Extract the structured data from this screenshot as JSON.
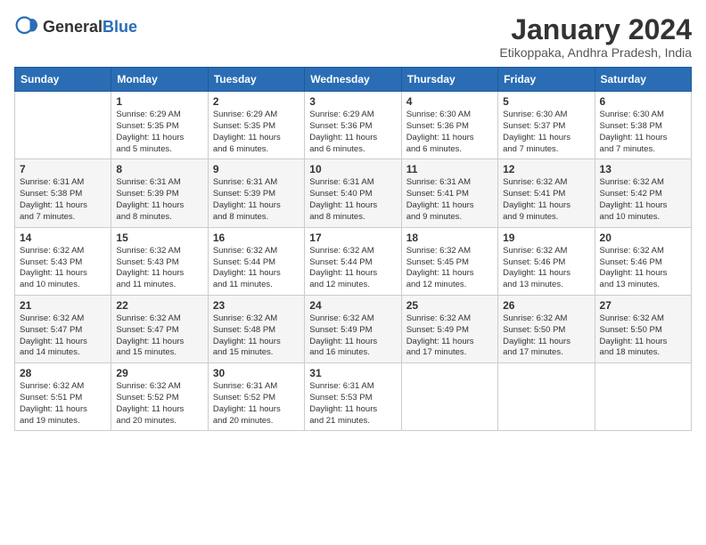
{
  "header": {
    "logo_general": "General",
    "logo_blue": "Blue",
    "month_title": "January 2024",
    "subtitle": "Etikoppaka, Andhra Pradesh, India"
  },
  "days_of_week": [
    "Sunday",
    "Monday",
    "Tuesday",
    "Wednesday",
    "Thursday",
    "Friday",
    "Saturday"
  ],
  "weeks": [
    [
      {
        "day": "",
        "info": ""
      },
      {
        "day": "1",
        "info": "Sunrise: 6:29 AM\nSunset: 5:35 PM\nDaylight: 11 hours\nand 5 minutes."
      },
      {
        "day": "2",
        "info": "Sunrise: 6:29 AM\nSunset: 5:35 PM\nDaylight: 11 hours\nand 6 minutes."
      },
      {
        "day": "3",
        "info": "Sunrise: 6:29 AM\nSunset: 5:36 PM\nDaylight: 11 hours\nand 6 minutes."
      },
      {
        "day": "4",
        "info": "Sunrise: 6:30 AM\nSunset: 5:36 PM\nDaylight: 11 hours\nand 6 minutes."
      },
      {
        "day": "5",
        "info": "Sunrise: 6:30 AM\nSunset: 5:37 PM\nDaylight: 11 hours\nand 7 minutes."
      },
      {
        "day": "6",
        "info": "Sunrise: 6:30 AM\nSunset: 5:38 PM\nDaylight: 11 hours\nand 7 minutes."
      }
    ],
    [
      {
        "day": "7",
        "info": "Sunrise: 6:31 AM\nSunset: 5:38 PM\nDaylight: 11 hours\nand 7 minutes."
      },
      {
        "day": "8",
        "info": "Sunrise: 6:31 AM\nSunset: 5:39 PM\nDaylight: 11 hours\nand 8 minutes."
      },
      {
        "day": "9",
        "info": "Sunrise: 6:31 AM\nSunset: 5:39 PM\nDaylight: 11 hours\nand 8 minutes."
      },
      {
        "day": "10",
        "info": "Sunrise: 6:31 AM\nSunset: 5:40 PM\nDaylight: 11 hours\nand 8 minutes."
      },
      {
        "day": "11",
        "info": "Sunrise: 6:31 AM\nSunset: 5:41 PM\nDaylight: 11 hours\nand 9 minutes."
      },
      {
        "day": "12",
        "info": "Sunrise: 6:32 AM\nSunset: 5:41 PM\nDaylight: 11 hours\nand 9 minutes."
      },
      {
        "day": "13",
        "info": "Sunrise: 6:32 AM\nSunset: 5:42 PM\nDaylight: 11 hours\nand 10 minutes."
      }
    ],
    [
      {
        "day": "14",
        "info": "Sunrise: 6:32 AM\nSunset: 5:43 PM\nDaylight: 11 hours\nand 10 minutes."
      },
      {
        "day": "15",
        "info": "Sunrise: 6:32 AM\nSunset: 5:43 PM\nDaylight: 11 hours\nand 11 minutes."
      },
      {
        "day": "16",
        "info": "Sunrise: 6:32 AM\nSunset: 5:44 PM\nDaylight: 11 hours\nand 11 minutes."
      },
      {
        "day": "17",
        "info": "Sunrise: 6:32 AM\nSunset: 5:44 PM\nDaylight: 11 hours\nand 12 minutes."
      },
      {
        "day": "18",
        "info": "Sunrise: 6:32 AM\nSunset: 5:45 PM\nDaylight: 11 hours\nand 12 minutes."
      },
      {
        "day": "19",
        "info": "Sunrise: 6:32 AM\nSunset: 5:46 PM\nDaylight: 11 hours\nand 13 minutes."
      },
      {
        "day": "20",
        "info": "Sunrise: 6:32 AM\nSunset: 5:46 PM\nDaylight: 11 hours\nand 13 minutes."
      }
    ],
    [
      {
        "day": "21",
        "info": "Sunrise: 6:32 AM\nSunset: 5:47 PM\nDaylight: 11 hours\nand 14 minutes."
      },
      {
        "day": "22",
        "info": "Sunrise: 6:32 AM\nSunset: 5:47 PM\nDaylight: 11 hours\nand 15 minutes."
      },
      {
        "day": "23",
        "info": "Sunrise: 6:32 AM\nSunset: 5:48 PM\nDaylight: 11 hours\nand 15 minutes."
      },
      {
        "day": "24",
        "info": "Sunrise: 6:32 AM\nSunset: 5:49 PM\nDaylight: 11 hours\nand 16 minutes."
      },
      {
        "day": "25",
        "info": "Sunrise: 6:32 AM\nSunset: 5:49 PM\nDaylight: 11 hours\nand 17 minutes."
      },
      {
        "day": "26",
        "info": "Sunrise: 6:32 AM\nSunset: 5:50 PM\nDaylight: 11 hours\nand 17 minutes."
      },
      {
        "day": "27",
        "info": "Sunrise: 6:32 AM\nSunset: 5:50 PM\nDaylight: 11 hours\nand 18 minutes."
      }
    ],
    [
      {
        "day": "28",
        "info": "Sunrise: 6:32 AM\nSunset: 5:51 PM\nDaylight: 11 hours\nand 19 minutes."
      },
      {
        "day": "29",
        "info": "Sunrise: 6:32 AM\nSunset: 5:52 PM\nDaylight: 11 hours\nand 20 minutes."
      },
      {
        "day": "30",
        "info": "Sunrise: 6:31 AM\nSunset: 5:52 PM\nDaylight: 11 hours\nand 20 minutes."
      },
      {
        "day": "31",
        "info": "Sunrise: 6:31 AM\nSunset: 5:53 PM\nDaylight: 11 hours\nand 21 minutes."
      },
      {
        "day": "",
        "info": ""
      },
      {
        "day": "",
        "info": ""
      },
      {
        "day": "",
        "info": ""
      }
    ]
  ]
}
